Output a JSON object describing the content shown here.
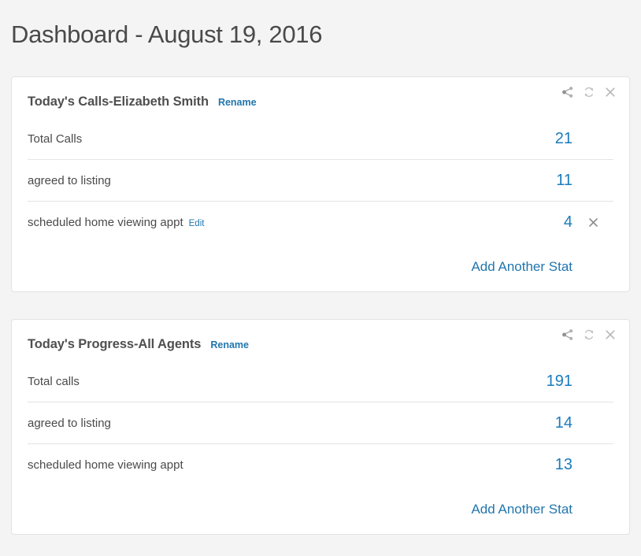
{
  "page": {
    "title": "Dashboard - August 19, 2016",
    "background_color": "#f4f4f4",
    "accent_color": "#2176ae",
    "value_color": "#1a7bbd"
  },
  "tools": {
    "share_icon": "share-icon",
    "refresh_icon": "refresh-icon",
    "close_icon": "close-icon"
  },
  "cards": [
    {
      "title": "Today's Calls-Elizabeth Smith",
      "rename_label": "Rename",
      "add_stat_label": "Add Another Stat",
      "rows": [
        {
          "label": "Total Calls",
          "value": "21",
          "edit_label": "",
          "removable": false
        },
        {
          "label": "agreed to listing",
          "value": "11",
          "edit_label": "",
          "removable": false
        },
        {
          "label": "scheduled home viewing appt",
          "value": "4",
          "edit_label": "Edit",
          "removable": true
        }
      ]
    },
    {
      "title": "Today's Progress-All Agents",
      "rename_label": "Rename",
      "add_stat_label": "Add Another Stat",
      "rows": [
        {
          "label": "Total calls",
          "value": "191",
          "edit_label": "",
          "removable": false
        },
        {
          "label": "agreed to listing",
          "value": "14",
          "edit_label": "",
          "removable": false
        },
        {
          "label": "scheduled home viewing appt",
          "value": "13",
          "edit_label": "",
          "removable": false
        }
      ]
    }
  ]
}
